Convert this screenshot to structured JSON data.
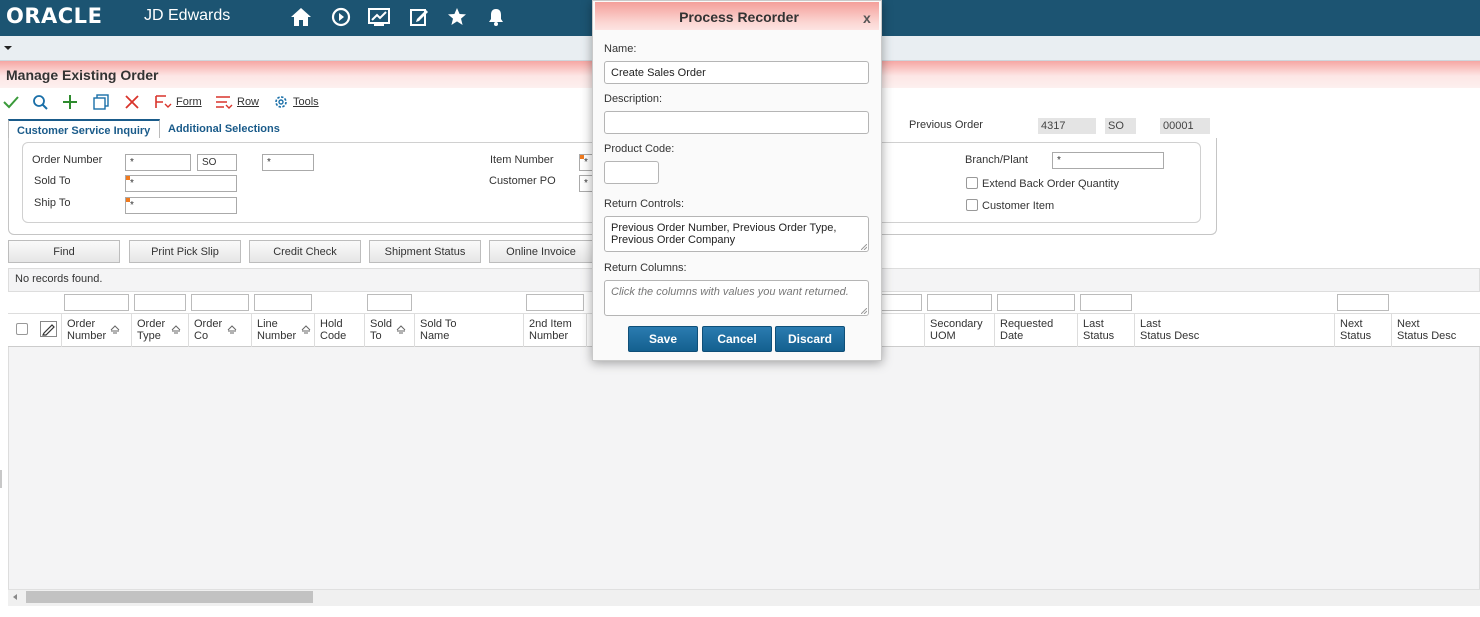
{
  "brand": {
    "oracle": "ORACLE",
    "jde": "JD Edwards"
  },
  "nav_icons": [
    "home-icon",
    "compass-icon",
    "chart-icon",
    "edit-icon",
    "star-icon",
    "bell-icon"
  ],
  "page_title": "Manage Existing Order",
  "toolbar": {
    "form_label": "Form",
    "row_label": "Row",
    "tools_label": "Tools"
  },
  "tabs": [
    {
      "label": "Customer Service Inquiry",
      "active": true
    },
    {
      "label": "Additional Selections",
      "active": false
    }
  ],
  "previous_order": {
    "label": "Previous Order",
    "number": "4317",
    "type": "SO",
    "company": "00001"
  },
  "form": {
    "order_number_label": "Order Number",
    "order_number_value": "*",
    "order_type_value": "SO",
    "order_company_value": "*",
    "sold_to_label": "Sold To",
    "sold_to_value": "*",
    "ship_to_label": "Ship To",
    "ship_to_value": "*",
    "item_number_label": "Item Number",
    "item_number_value": "*",
    "customer_po_label": "Customer PO",
    "customer_po_value": "*",
    "branch_plant_label": "Branch/Plant",
    "branch_plant_value": "*",
    "extend_back_order_label": "Extend Back Order Quantity",
    "customer_item_label": "Customer Item"
  },
  "action_buttons": [
    "Find",
    "Print Pick Slip",
    "Credit Check",
    "Shipment Status",
    "Online Invoice"
  ],
  "grid": {
    "empty_message": "No records found.",
    "columns": [
      {
        "line1": "Order",
        "line2": "Number"
      },
      {
        "line1": "Order",
        "line2": "Type"
      },
      {
        "line1": "Order",
        "line2": "Co"
      },
      {
        "line1": "Line",
        "line2": "Number"
      },
      {
        "line1": "Hold",
        "line2": "Code"
      },
      {
        "line1": "Sold",
        "line2": "To"
      },
      {
        "line1": "Sold To",
        "line2": "Name"
      },
      {
        "line1": "2nd Item",
        "line2": "Number"
      },
      {
        "line1": "Secondary",
        "line2": "UOM"
      },
      {
        "line1": "Requested",
        "line2": "Date"
      },
      {
        "line1": "Last",
        "line2": "Status"
      },
      {
        "line1": "Last",
        "line2": "Status Desc"
      },
      {
        "line1": "Next",
        "line2": "Status"
      },
      {
        "line1": "Next",
        "line2": "Status Desc"
      }
    ]
  },
  "modal": {
    "title": "Process Recorder",
    "close_label": "x",
    "name_label": "Name:",
    "name_value": "Create Sales Order",
    "description_label": "Description:",
    "description_value": "",
    "product_code_label": "Product Code:",
    "product_code_value": "",
    "return_controls_label": "Return Controls:",
    "return_controls_value": "Previous Order Number, Previous Order Type, Previous Order Company",
    "return_columns_label": "Return Columns:",
    "return_columns_placeholder": "Click the columns with values you want returned.",
    "save_label": "Save",
    "cancel_label": "Cancel",
    "discard_label": "Discard"
  },
  "colors": {
    "navbar": "#1c5472",
    "accent": "#1a5b8a",
    "title_gradient": "#f6a6a3",
    "required_marker": "#f07a1e",
    "modal_button": "#1d6fa3"
  }
}
